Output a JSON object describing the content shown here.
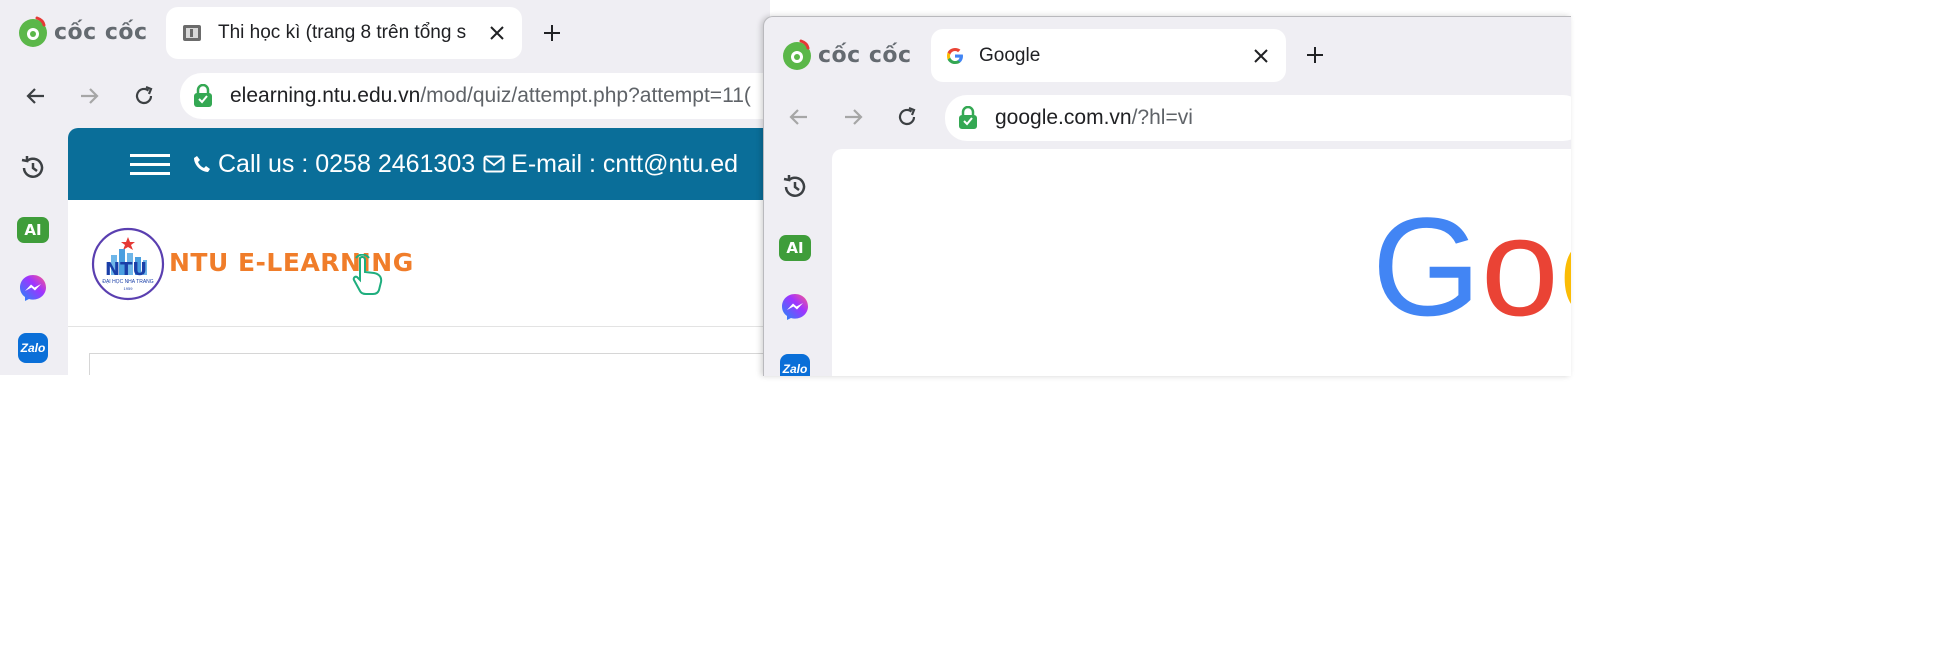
{
  "browser": {
    "brand_name": "cốc cốc"
  },
  "left_window": {
    "tab": {
      "title": "Thi học kì (trang 8 trên tổng s",
      "icon": "page-favicon"
    },
    "url": {
      "domain": "elearning.ntu.edu.vn",
      "path": "/mod/quiz/attempt.php?attempt=11("
    },
    "sidebar": [
      "history-icon",
      "ai-assistant-icon",
      "messenger-icon",
      "zalo-icon"
    ],
    "site": {
      "call_label": "Call us : 0258 2461303",
      "email_label": "E-mail : cntt@ntu.ed",
      "logo_initials": "NTU",
      "logo_caption": "ĐẠI HỌC NHA TRANG",
      "logo_year": "1959",
      "title": "NTU E-LEARNING"
    }
  },
  "right_window": {
    "tab": {
      "title": "Google",
      "icon": "google-favicon"
    },
    "url": {
      "domain": "google.com.vn",
      "path": "/?hl=vi"
    },
    "sidebar": [
      "history-icon",
      "ai-assistant-icon",
      "messenger-icon",
      "zalo-icon"
    ],
    "logo_letters": [
      "G",
      "o",
      "o"
    ]
  },
  "sidebar_labels": {
    "ai": "AI",
    "zalo": "Zalo"
  },
  "colors": {
    "header_blue": "#0a6e99",
    "ntu_orange": "#f07d2a",
    "google_blue": "#4285F4",
    "google_red": "#EA4335",
    "google_yellow": "#FBBC05",
    "secure_green": "#34a853"
  }
}
